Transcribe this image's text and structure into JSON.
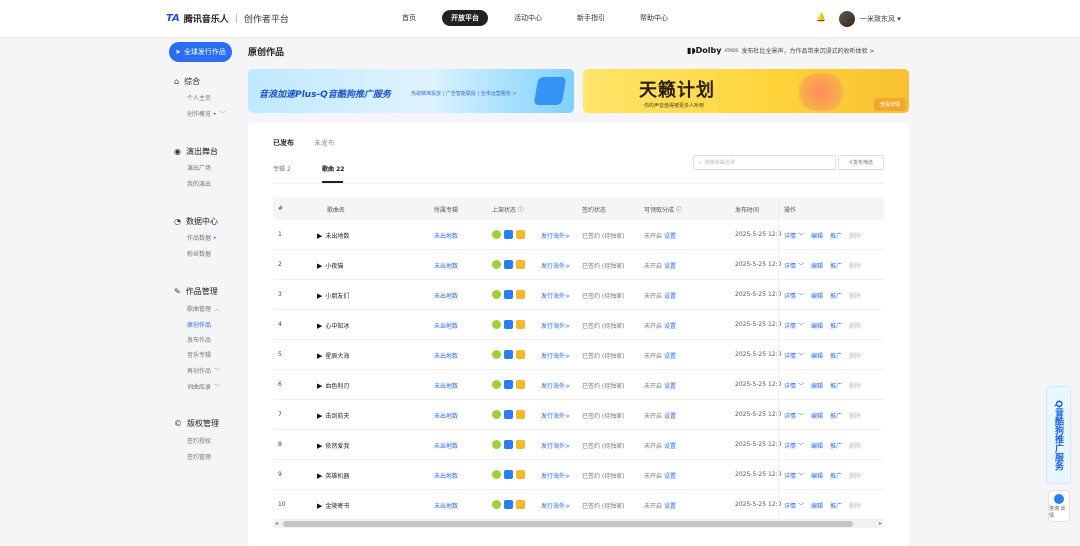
{
  "header": {
    "logo_mark": "TA",
    "logo_text": "腾讯音乐人",
    "logo_sub": "创作者平台",
    "nav": [
      "首页",
      "开放平台",
      "活动中心",
      "新手指引",
      "帮助中心"
    ],
    "active_nav": "开放平台",
    "username": "一米致东风"
  },
  "sidebar": {
    "publish_label": "全球发行作品",
    "sections": [
      {
        "label": "综合",
        "icon": "home-icon",
        "items": [
          {
            "label": "个人主页"
          },
          {
            "label": "创作概览",
            "dot": true,
            "chevron": true
          }
        ]
      },
      {
        "label": "演出舞台",
        "icon": "stage-icon",
        "items": [
          {
            "label": "演出广场"
          },
          {
            "label": "我的演出"
          }
        ]
      },
      {
        "label": "数据中心",
        "icon": "chart-icon",
        "items": [
          {
            "label": "作品数据",
            "dot": true
          },
          {
            "label": "粉丝数据"
          }
        ]
      },
      {
        "label": "作品管理",
        "icon": "edit-icon",
        "items": [
          {
            "label": "歌曲管理",
            "chevron": true
          },
          {
            "label": "原创作品",
            "selected": true
          },
          {
            "label": "发布作品"
          },
          {
            "label": "音乐专辑"
          },
          {
            "label": "再创作品",
            "chevron": true
          },
          {
            "label": "词曲库录",
            "chevron": true
          }
        ]
      },
      {
        "label": "版权管理",
        "icon": "copyright-icon",
        "items": [
          {
            "label": "签约授权"
          },
          {
            "label": "签约管理"
          }
        ]
      }
    ]
  },
  "main": {
    "title": "原创作品",
    "dolby_brand": "Dolby",
    "dolby_atmos": "ATMOS",
    "dolby_text": "发布杜比全景声，为作品带来沉浸式的收听体验 >",
    "banner1_title": "音浪加速Plus-Q音酷狗推广服务",
    "banner1_tags": "热歌精准投放 | 广告智能联投 | 全未运营服务 >",
    "banner2_title": "天籁计划",
    "banner2_sub": "你的声音值得被更多人听到",
    "banner2_btn": "查看详情",
    "tabs": [
      "已发布",
      "未发布"
    ],
    "subtabs": [
      "专辑 2",
      "歌曲 22"
    ],
    "search_placeholder": "搜索歌曲名称",
    "filter_label": "发布筛选"
  },
  "table": {
    "headers": [
      "#",
      "歌曲名",
      "所属专辑",
      "上架状态 ⓘ",
      "签约状态",
      "可领取分成 ⓘ",
      "发布时间",
      "操作"
    ],
    "rows": [
      {
        "num": "1",
        "name": "未出地数",
        "album": "未出地数",
        "mod": "发行海外>",
        "sign": "已签约 (待独家)",
        "open": "未开启",
        "setting": "设置",
        "date": "2025-5-25 12:0"
      },
      {
        "num": "2",
        "name": "小夜猫",
        "album": "未出地数",
        "mod": "发行海外>",
        "sign": "已签约 (待独家)",
        "open": "未开启",
        "setting": "设置",
        "date": "2025-5-25 12:0"
      },
      {
        "num": "3",
        "name": "小朋友们",
        "album": "未出地数",
        "mod": "发行海外>",
        "sign": "已签约 (待独家)",
        "open": "未开启",
        "setting": "设置",
        "date": "2025-5-25 12:0"
      },
      {
        "num": "4",
        "name": "心中知冰",
        "album": "未出地数",
        "mod": "发行海外>",
        "sign": "已签约 (待独家)",
        "open": "未开启",
        "setting": "设置",
        "date": "2025-5-25 12:0"
      },
      {
        "num": "5",
        "name": "星辰大海",
        "album": "未出地数",
        "mod": "发行海外>",
        "sign": "已签约 (待独家)",
        "open": "未开启",
        "setting": "设置",
        "date": "2025-5-25 12:0"
      },
      {
        "num": "6",
        "name": "血色利刃",
        "album": "未出地数",
        "mod": "发行海外>",
        "sign": "已签约 (待独家)",
        "open": "未开启",
        "setting": "设置",
        "date": "2025-5-25 12:0"
      },
      {
        "num": "7",
        "name": "击剑前夫",
        "album": "未出地数",
        "mod": "发行海外>",
        "sign": "已签约 (待独家)",
        "open": "未开启",
        "setting": "设置",
        "date": "2025-5-25 12:0"
      },
      {
        "num": "8",
        "name": "依然爱我",
        "album": "未出地数",
        "mod": "发行海外>",
        "sign": "已签约 (待独家)",
        "open": "未开启",
        "setting": "设置",
        "date": "2025-5-25 12:0"
      },
      {
        "num": "9",
        "name": "英雄机器",
        "album": "未出地数",
        "mod": "发行海外>",
        "sign": "已签约 (待独家)",
        "open": "未开启",
        "setting": "设置",
        "date": "2025-5-25 12:0"
      },
      {
        "num": "10",
        "name": "金陵寄书",
        "album": "未出地数",
        "mod": "发行海外>",
        "sign": "已签约 (待独家)",
        "open": "未开启",
        "setting": "设置",
        "date": "2025-5-25 12:0"
      }
    ],
    "ops": [
      "详情",
      "编辑",
      "推广",
      "删除"
    ]
  },
  "float": {
    "promo_label": "Q音酷狗推广服务",
    "help_label": "咨询 反馈"
  }
}
